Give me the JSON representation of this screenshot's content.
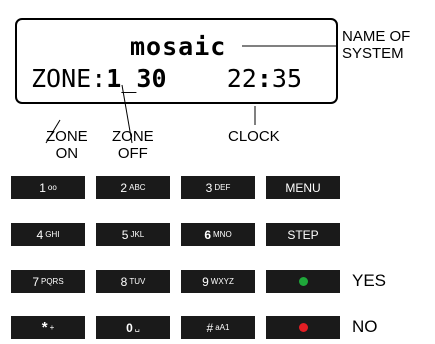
{
  "display": {
    "line1": "mosaic",
    "zone_prefix": "ZONE:",
    "zone_on": "1",
    "zone_sep": "_",
    "zone_off": "30",
    "clock_hours": "22",
    "clock_sep": ":",
    "clock_minutes": "35"
  },
  "annotations": {
    "name_of_system_line1": "NAME OF",
    "name_of_system_line2": "SYSTEM",
    "zone_on_line1": "ZONE",
    "zone_on_line2": "ON",
    "zone_off_line1": "ZONE",
    "zone_off_line2": "OFF",
    "clock": "CLOCK",
    "yes": "YES",
    "no": "NO"
  },
  "keys": [
    {
      "main": "1",
      "sub": "oo"
    },
    {
      "main": "2",
      "sub": "ABC"
    },
    {
      "main": "3",
      "sub": "DEF"
    },
    {
      "main": "MENU",
      "sub": ""
    },
    {
      "main": "4",
      "sub": "GHI"
    },
    {
      "main": "5",
      "sub": "JKL"
    },
    {
      "main": "6",
      "sub": "MNO"
    },
    {
      "main": "STEP",
      "sub": ""
    },
    {
      "main": "7",
      "sub": "PQRS"
    },
    {
      "main": "8",
      "sub": "TUV"
    },
    {
      "main": "9",
      "sub": "WXYZ"
    },
    {
      "main": "",
      "sub": "",
      "icon": "green-dot"
    },
    {
      "main": "*",
      "sub": "+"
    },
    {
      "main": "0",
      "sub": "␣"
    },
    {
      "main": "#",
      "sub": "aA1"
    },
    {
      "main": "",
      "sub": "",
      "icon": "red-dot"
    }
  ],
  "colors": {
    "key_background": "#1a1a1a",
    "key_text": "#ffffff",
    "yes_dot": "#1fa83a",
    "no_dot": "#e31e24"
  }
}
